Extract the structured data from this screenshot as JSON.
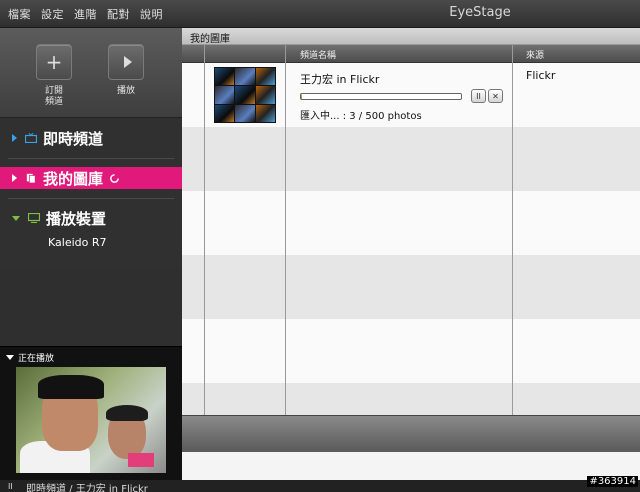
{
  "menu": [
    "檔案",
    "設定",
    "進階",
    "配對",
    "說明"
  ],
  "app_title": "EyeStage",
  "toolbar": {
    "subscribe_label_line1": "訂閱",
    "subscribe_label_line2": "頻道",
    "play_label": "播放"
  },
  "sidebar": {
    "live_channels": "即時頻道",
    "my_library": "我的圖庫",
    "playback_devices": "播放裝置",
    "device_name": "Kaleido R7",
    "now_playing": "正在播放"
  },
  "main": {
    "section_title": "我的圖庫",
    "col_channel_name": "頻道名稱",
    "col_source": "來源",
    "item": {
      "name": "王力宏 in Flickr",
      "progress": 0.006,
      "status": "匯入中... : 3 / 500 photos",
      "source": "Flickr"
    }
  },
  "status_bar": {
    "pause_symbol": "II",
    "text": "即時頻道 / 王力宏 in Flickr"
  },
  "watermark": "#363914",
  "colors": {
    "accent_pink": "#e0197a",
    "live_blue": "#3aa0e8",
    "device_green": "#7bc043"
  }
}
